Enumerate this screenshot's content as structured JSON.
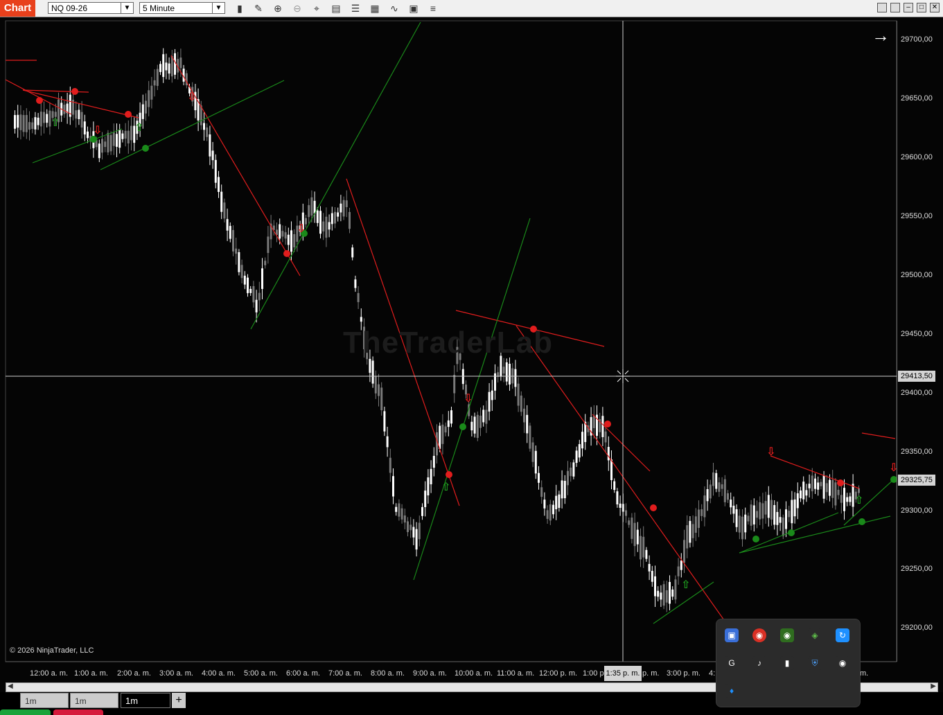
{
  "toolbar": {
    "tab_label": "Chart",
    "instrument": "NQ 09-26",
    "interval": "5 Minute",
    "tools": [
      "bar-type-icon",
      "pencil-icon",
      "zoom-in-icon",
      "zoom-out-icon",
      "crosshair-icon",
      "properties-icon",
      "templates-icon",
      "indicators-icon",
      "strategies-icon",
      "chart-trader-icon",
      "menu-icon"
    ]
  },
  "chart": {
    "watermark": "TheTraderLab",
    "copyright": "© 2026 NinjaTrader, LLC",
    "crosshair_price": "29413,50",
    "crosshair_time": "1:35 p. m.",
    "last_price": "29325,75",
    "price_labels": [
      "29700,00",
      "29650,00",
      "29600,00",
      "29550,00",
      "29500,00",
      "29450,00",
      "29400,00",
      "29350,00",
      "29300,00",
      "29250,00",
      "29200,00"
    ],
    "time_labels": [
      "12:00 a. m.",
      "1:00 a. m.",
      "2:00 a. m.",
      "3:00 a. m.",
      "4:00 a. m.",
      "5:00 a. m.",
      "6:00 a. m.",
      "7:00 a. m.",
      "8:00 a. m.",
      "9:00 a. m.",
      "10:00 a. m.",
      "11:00 a. m.",
      "12:00 p. m.",
      "1:00 p.",
      "p. m.",
      "3:00 p. m.",
      "4:",
      "m."
    ],
    "colors": {
      "bull": "#ffffff",
      "bear": "#7a7a7a",
      "resistance": "#e11d1d",
      "support": "#1a8a1a",
      "background": "#050505"
    }
  },
  "tabs": {
    "tab1": "1m",
    "tab2": "1m",
    "active": "1m",
    "add": "+"
  },
  "tray": {
    "icons": [
      "display-icon",
      "chrome-icon",
      "nvidia-icon",
      "network-icon",
      "app-icon",
      "g-icon",
      "audio-icon",
      "usb-icon",
      "defender-icon",
      "steam-icon",
      "bluetooth-icon"
    ]
  }
}
